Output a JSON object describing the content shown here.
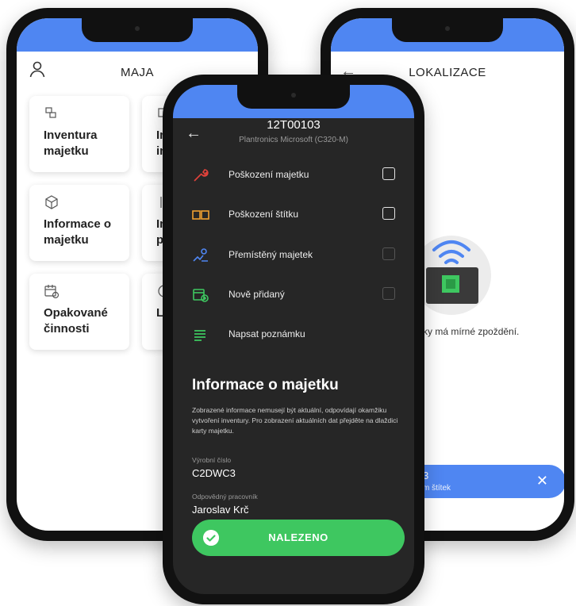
{
  "left_screen": {
    "title": "MAJA",
    "tiles": [
      {
        "label": "Inventura\nmajetku",
        "icon": "boxes-icon"
      },
      {
        "label": "In\nin",
        "icon": "box-list-icon"
      },
      {
        "label": "Informace o\nmajetku",
        "icon": "package-icon"
      },
      {
        "label": "In\np",
        "icon": "transfer-icon"
      },
      {
        "label": "Opakované\nčinnosti",
        "icon": "calendar-repeat-icon"
      },
      {
        "label": "L",
        "icon": "location-icon"
      }
    ]
  },
  "right_screen": {
    "title": "LOKALIZACE",
    "message": "tečky má mírné zpoždění.",
    "banner": {
      "line1": "3",
      "line2": "m štítek"
    }
  },
  "main_screen": {
    "asset_code": "12T00103",
    "asset_name": "Plantronics Microsoft (C320-M)",
    "options": [
      {
        "label": "Poškození majetku",
        "icon": "wrench-icon",
        "color": "#e0413a"
      },
      {
        "label": "Poškození štítku",
        "icon": "label-icon",
        "color": "#f0a030"
      },
      {
        "label": "Přemístěný majetek",
        "icon": "move-icon",
        "color": "#4f86f2"
      },
      {
        "label": "Nově přidaný",
        "icon": "calendar-plus-icon",
        "color": "#3ec760"
      },
      {
        "label": "Napsat poznámku",
        "icon": "note-lines-icon",
        "color": "#3ec760"
      }
    ],
    "section_title": "Informace o majetku",
    "note": "Zobrazené informace nemusejí být aktuální, odpovídají okamžiku vytvoření inventury. Pro zobrazení aktuálních dat přejděte na dlaždici karty majetku.",
    "fields": [
      {
        "label": "Výrobní číslo",
        "value": "C2DWC3"
      },
      {
        "label": "Odpovědný pracovník",
        "value": "Jaroslav Krč"
      }
    ],
    "button_label": "NALEZENO"
  },
  "colors": {
    "accent": "#4f86f2",
    "success": "#3ec760",
    "dark_bg": "#262626"
  }
}
